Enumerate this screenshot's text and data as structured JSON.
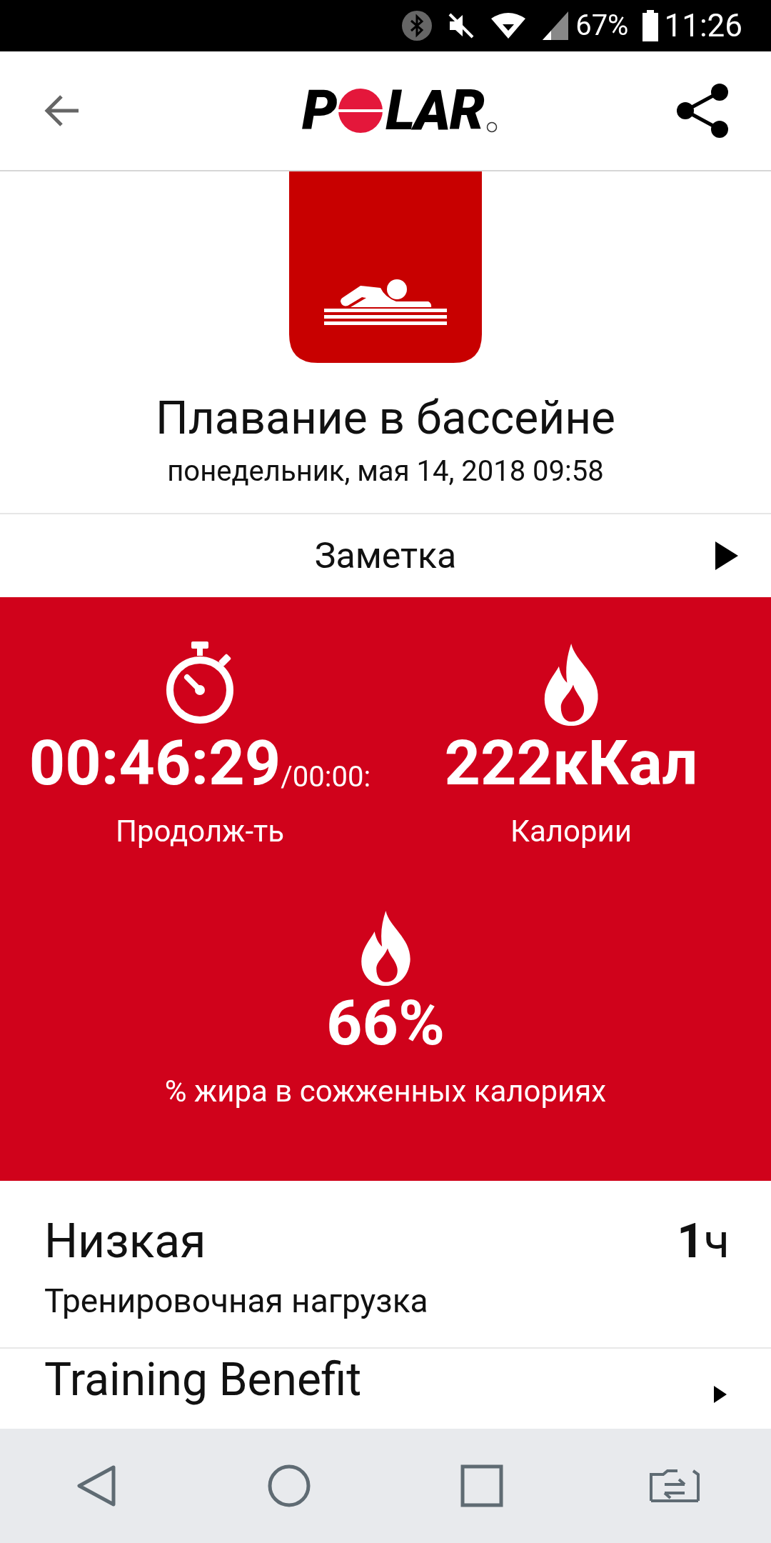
{
  "status_bar": {
    "battery": "67%",
    "time": "11:26"
  },
  "header": {
    "logo_start": "P",
    "logo_end": "LAR"
  },
  "activity": {
    "title": "Плавание в бассейне",
    "datetime": "понедельник, мая 14, 2018 09:58"
  },
  "note": {
    "label": "Заметка"
  },
  "stats": [
    {
      "kind": "timer",
      "value": "00:46:29",
      "suffix": "/00:00:",
      "label": "Продолж-ть"
    },
    {
      "kind": "flame",
      "value": "222кКал",
      "label": "Калории"
    },
    {
      "kind": "flame",
      "value": "66%",
      "label": "% жира в сожженных калориях"
    }
  ],
  "training_load": {
    "level": "Низкая",
    "duration_number": "1",
    "duration_unit": "ч",
    "label": "Тренировочная нагрузка"
  },
  "training_benefit": {
    "label": "Training Benefit"
  }
}
